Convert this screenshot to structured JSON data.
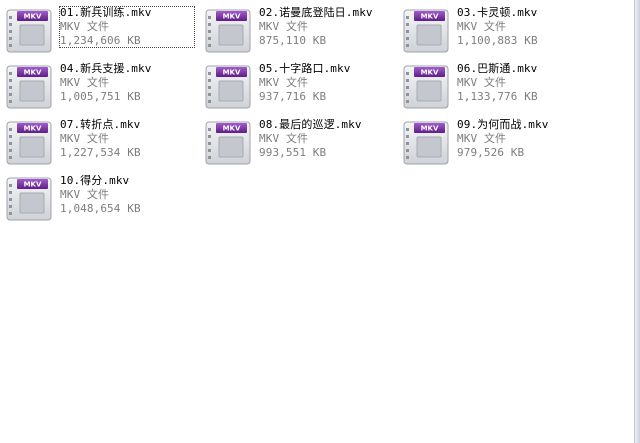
{
  "files": [
    {
      "name": "01.新兵训练.mkv",
      "type": "MKV 文件",
      "size": "1,234,606 KB",
      "icon": "mkv-video-icon",
      "icon_label": "MKV"
    },
    {
      "name": "02.诺曼底登陆日.mkv",
      "type": "MKV 文件",
      "size": "875,110 KB",
      "icon": "mkv-video-icon",
      "icon_label": "MKV"
    },
    {
      "name": "03.卡灵顿.mkv",
      "type": "MKV 文件",
      "size": "1,100,883 KB",
      "icon": "mkv-video-icon",
      "icon_label": "MKV"
    },
    {
      "name": "04.新兵支援.mkv",
      "type": "MKV 文件",
      "size": "1,005,751 KB",
      "icon": "mkv-video-icon",
      "icon_label": "MKV"
    },
    {
      "name": "05.十字路口.mkv",
      "type": "MKV 文件",
      "size": "937,716 KB",
      "icon": "mkv-video-icon",
      "icon_label": "MKV"
    },
    {
      "name": "06.巴斯通.mkv",
      "type": "MKV 文件",
      "size": "1,133,776 KB",
      "icon": "mkv-video-icon",
      "icon_label": "MKV"
    },
    {
      "name": "07.转折点.mkv",
      "type": "MKV 文件",
      "size": "1,227,534 KB",
      "icon": "mkv-video-icon",
      "icon_label": "MKV"
    },
    {
      "name": "08.最后的巡逻.mkv",
      "type": "MKV 文件",
      "size": "993,551 KB",
      "icon": "mkv-video-icon",
      "icon_label": "MKV"
    },
    {
      "name": "09.为何而战.mkv",
      "type": "MKV 文件",
      "size": "979,526 KB",
      "icon": "mkv-video-icon",
      "icon_label": "MKV"
    },
    {
      "name": "10.得分.mkv",
      "type": "MKV 文件",
      "size": "1,048,654 KB",
      "icon": "mkv-video-icon",
      "icon_label": "MKV"
    }
  ],
  "colors": {
    "badge_purple": "#7b2fa8",
    "icon_body": "#e2e4e7",
    "secondary_text": "#7d7d7d"
  }
}
